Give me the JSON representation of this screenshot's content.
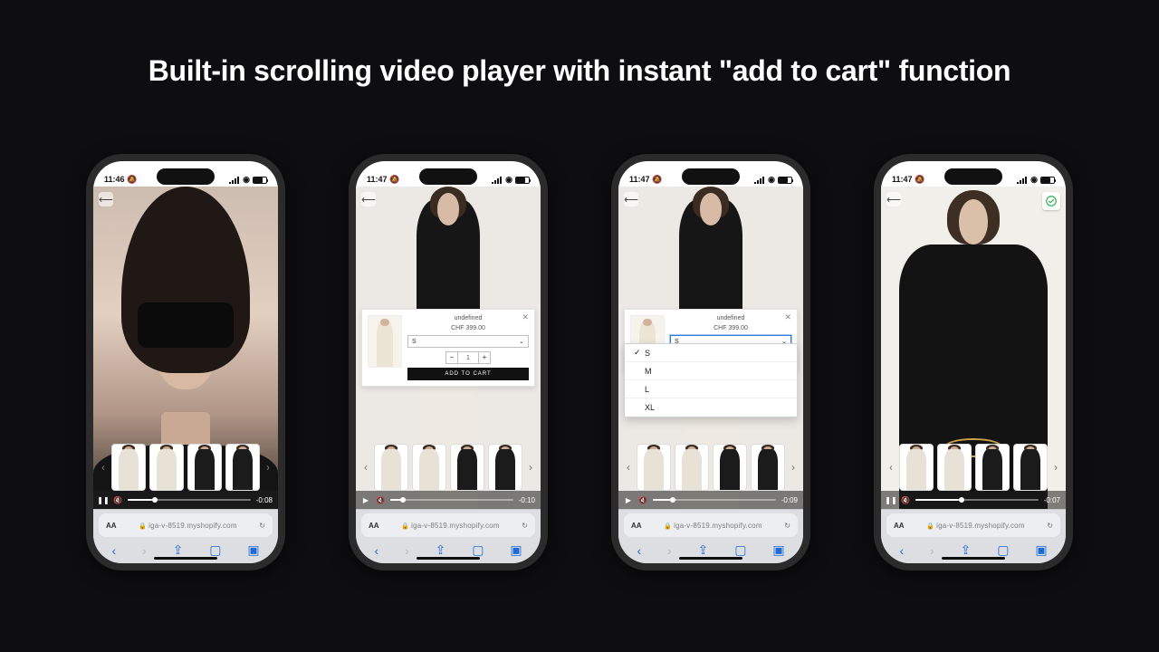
{
  "headline": "Built-in scrolling video player with instant \"add to cart\" function",
  "status": {
    "time1": "11:46",
    "time2": "11:47",
    "silent_icon": "🔕"
  },
  "safari": {
    "aa": "AA",
    "domain": "iga-v-8519.myshopify.com",
    "reload": "↻"
  },
  "video": {
    "t1": "-0:08",
    "t2": "-0:10",
    "t3": "-0:09",
    "t4": "-0:07",
    "p1": 20,
    "p2": 8,
    "p3": 14,
    "p4": 35
  },
  "sheet": {
    "title": "undefined",
    "price": "CHF 399.00",
    "size_selected": "S",
    "qty": "1",
    "atc": "ADD TO CART"
  },
  "sizes": [
    "S",
    "M",
    "L",
    "XL"
  ]
}
